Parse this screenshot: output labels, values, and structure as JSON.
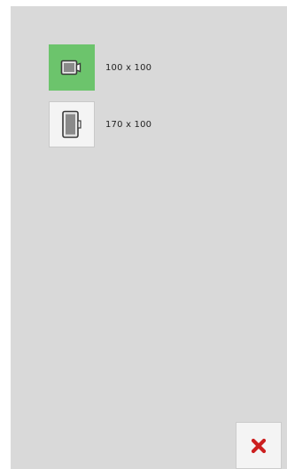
{
  "options": [
    {
      "label": "100 x 100",
      "icon": "hoop-small-icon",
      "selected": true
    },
    {
      "label": "170 x 100",
      "icon": "hoop-large-icon",
      "selected": false
    }
  ],
  "close": {
    "icon": "close-x-icon",
    "color": "#cc1f1f"
  },
  "colors": {
    "panel": "#d9d9d9",
    "selected": "#6cc46c",
    "tile": "#f4f4f4"
  }
}
